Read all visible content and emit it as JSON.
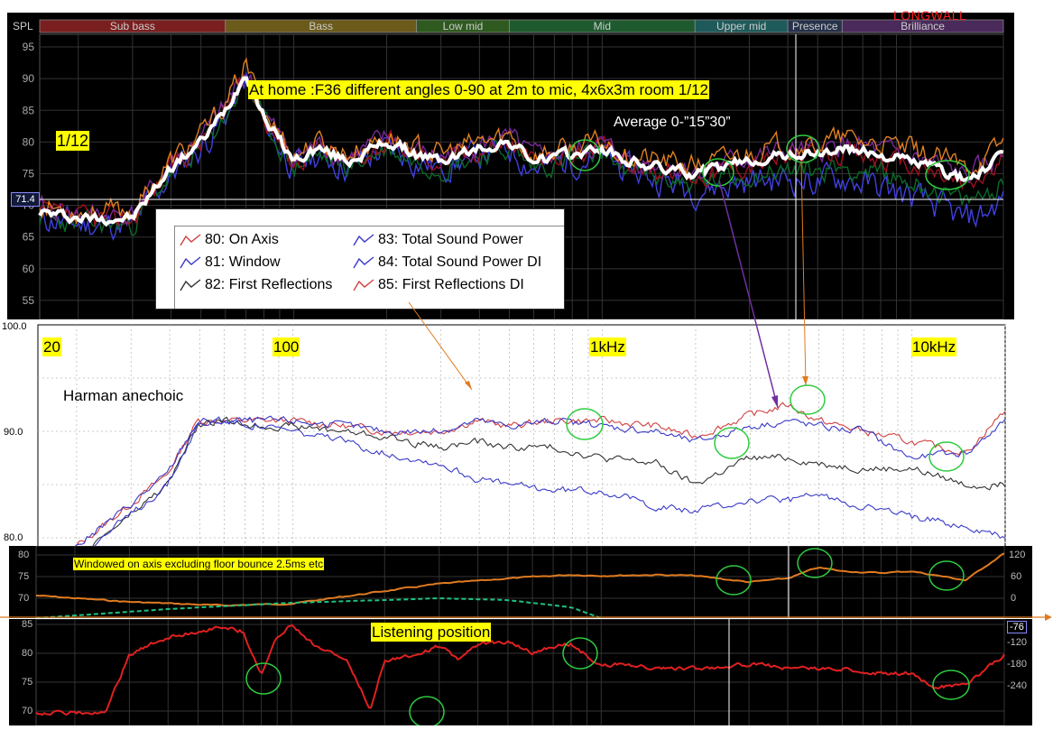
{
  "top_panel": {
    "spl_label": "SPL",
    "bands": [
      {
        "name": "Sub bass",
        "color": "#7a1f1f"
      },
      {
        "name": "Bass",
        "color": "#6b5a1a"
      },
      {
        "name": "Low mid",
        "color": "#2f5a1f"
      },
      {
        "name": "Mid",
        "color": "#1f5a2f"
      },
      {
        "name": "Upper mid",
        "color": "#1f5a5a"
      },
      {
        "name": "Presence",
        "color": "#26324a"
      },
      {
        "name": "Brilliance",
        "color": "#4a2a5a"
      }
    ],
    "watermark": "LONGWALL",
    "y_ticks": [
      "95",
      "90",
      "85",
      "80",
      "75",
      "70",
      "65",
      "60",
      "55"
    ],
    "cursor_value": "71.4",
    "annotation_title": "At home :F36 different angles 0-90 at 2m to mic, 4x6x3m room  1/12",
    "annotation_average": "Average 0-”15”30”",
    "annotation_smoothing": "1/12"
  },
  "legend": {
    "items": [
      {
        "label": "80: On Axis",
        "color": "#d04040"
      },
      {
        "label": "81: Window",
        "color": "#3a3ac8"
      },
      {
        "label": "82: First Reflections",
        "color": "#333333"
      },
      {
        "label": "83: Total Sound Power",
        "color": "#3a3ac8"
      },
      {
        "label": "84: Total Sound Power DI",
        "color": "#3a3ac8"
      },
      {
        "label": "85: First Reflections DI",
        "color": "#d04040"
      }
    ]
  },
  "harman_panel": {
    "y_ticks": [
      "100.0",
      "90.0",
      "80.0"
    ],
    "label_20": "20",
    "label_100": "100",
    "label_1k": "1kHz",
    "label_10k": "10kHz",
    "title": "Harman anechoic"
  },
  "window_panel": {
    "y_left": [
      "80",
      "75",
      "70"
    ],
    "y_right": [
      "120",
      "60",
      "0"
    ],
    "annotation": "Windowed on axis excluding floor bounce 2.5ms etc"
  },
  "listening_panel": {
    "y_left": [
      "85",
      "80",
      "75",
      "70"
    ],
    "y_right": [
      "-76",
      "-120",
      "-180",
      "-240"
    ],
    "annotation": "Listening position"
  },
  "chart_data": [
    {
      "type": "line",
      "title": "At home :F36 different angles 0-90 at 2m to mic, 4x6x3m room  1/12",
      "ylabel": "SPL",
      "x_scale": "log",
      "xlim": [
        15,
        20000
      ],
      "ylim": [
        52,
        97
      ],
      "series": [
        {
          "name": "Average 0-”15”30”",
          "color": "#ffffff",
          "x": [
            15,
            20,
            25,
            30,
            40,
            50,
            60,
            70,
            80,
            100,
            120,
            150,
            200,
            250,
            300,
            400,
            500,
            600,
            800,
            1000,
            1200,
            1500,
            2000,
            2500,
            3000,
            4000,
            5000,
            6000,
            8000,
            10000,
            12000,
            15000,
            18000,
            20000
          ],
          "y": [
            69,
            68,
            68,
            68,
            76,
            80,
            85,
            91,
            84,
            77,
            79,
            77,
            80,
            78,
            77,
            79,
            80,
            77,
            78,
            79,
            77,
            76,
            75,
            76,
            77,
            78,
            78,
            79,
            78,
            77,
            76,
            74,
            76,
            78
          ]
        }
      ]
    },
    {
      "type": "line",
      "title": "Harman anechoic",
      "x_scale": "log",
      "xlim": [
        15,
        20000
      ],
      "ylim": [
        80,
        100
      ],
      "series": [
        {
          "name": "80: On Axis",
          "color": "#d04040",
          "x": [
            20,
            30,
            40,
            50,
            60,
            80,
            100,
            150,
            200,
            300,
            400,
            500,
            700,
            1000,
            1500,
            2000,
            3000,
            4000,
            5000,
            7000,
            10000,
            15000,
            20000
          ],
          "y": [
            79,
            83,
            86,
            91,
            91,
            91,
            91,
            90.5,
            90,
            90,
            91,
            90.5,
            91,
            91,
            90.5,
            89.5,
            91.5,
            92.5,
            91,
            90,
            89,
            88,
            92
          ]
        },
        {
          "name": "81: Window",
          "color": "#3a3ac8",
          "x": [
            20,
            30,
            40,
            50,
            60,
            80,
            100,
            150,
            200,
            300,
            400,
            500,
            700,
            1000,
            1500,
            2000,
            3000,
            4000,
            5000,
            7000,
            10000,
            15000,
            20000
          ],
          "y": [
            79,
            83,
            86,
            91,
            91,
            91,
            91,
            90.5,
            90,
            90,
            91,
            90.5,
            91,
            90.5,
            90,
            89,
            90.5,
            91,
            90.5,
            90,
            87.5,
            88,
            91
          ]
        },
        {
          "name": "82: First Reflections",
          "color": "#333333",
          "x": [
            20,
            30,
            40,
            50,
            60,
            80,
            100,
            150,
            200,
            300,
            400,
            500,
            700,
            1000,
            1500,
            2000,
            3000,
            4000,
            5000,
            7000,
            10000,
            15000,
            20000
          ],
          "y": [
            78,
            82,
            85,
            90.5,
            91,
            90.5,
            90.5,
            90,
            89.5,
            88.5,
            89,
            88.5,
            88.5,
            87.5,
            87,
            85,
            87.5,
            87.5,
            87,
            86.5,
            86.5,
            85,
            85
          ]
        },
        {
          "name": "83: Total Sound Power",
          "color": "#3a3ac8",
          "x": [
            20,
            30,
            40,
            50,
            60,
            80,
            100,
            150,
            200,
            300,
            400,
            500,
            700,
            1000,
            1500,
            2000,
            3000,
            4000,
            5000,
            7000,
            10000,
            15000,
            20000
          ],
          "y": [
            78,
            82,
            85,
            90.5,
            91,
            90.5,
            90,
            89,
            88,
            87,
            85.5,
            85,
            84.5,
            84.5,
            83,
            82.5,
            83.5,
            83.5,
            84,
            83,
            82,
            81,
            80
          ]
        }
      ]
    }
  ]
}
